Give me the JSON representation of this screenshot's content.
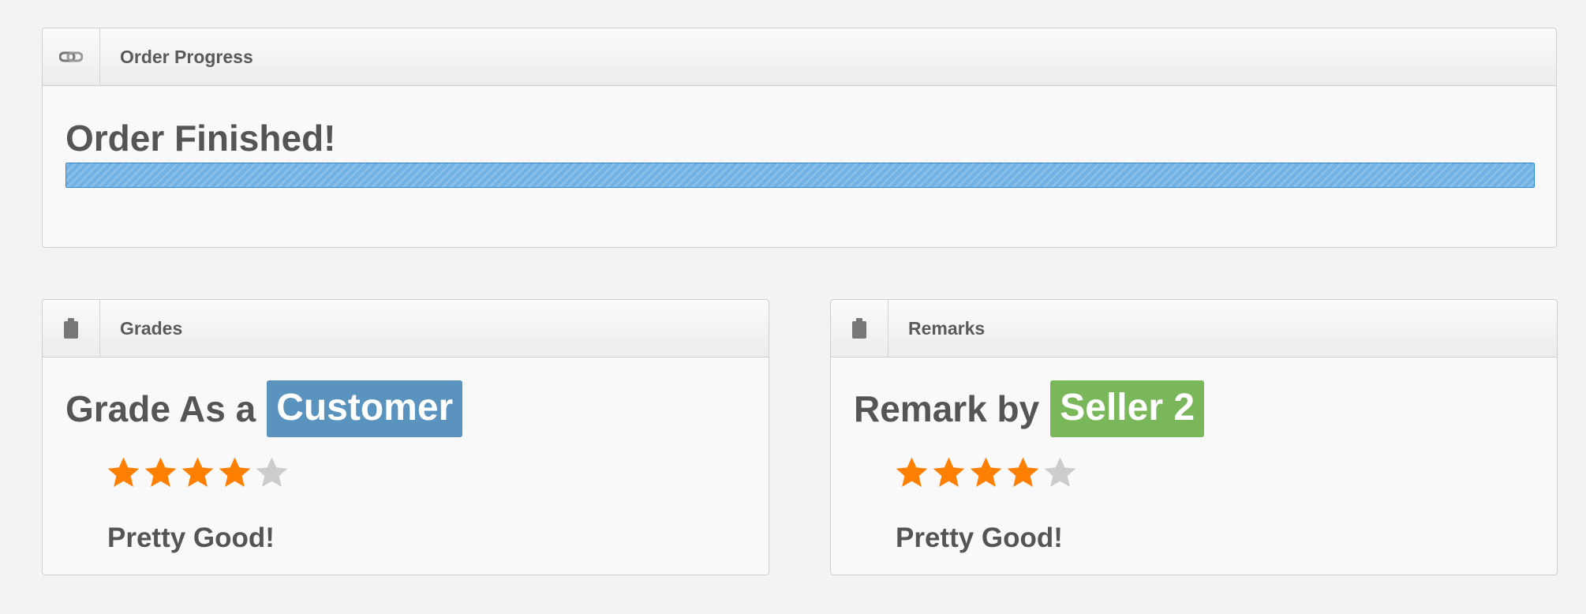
{
  "progress_panel": {
    "title": "Order Progress",
    "icon": "link-icon",
    "status_text": "Order Finished!",
    "progress_percent": 100,
    "bar_color": "#71b1e3"
  },
  "grades_panel": {
    "title": "Grades",
    "icon": "clipboard-icon",
    "heading": "Grade As a",
    "badge": "Customer",
    "badge_color": "#5b93bf",
    "rating": 4,
    "max_rating": 5,
    "comment": "Pretty Good!"
  },
  "remarks_panel": {
    "title": "Remarks",
    "icon": "clipboard-icon",
    "heading": "Remark by",
    "badge": "Seller 2",
    "badge_color": "#79b75a",
    "rating": 4,
    "max_rating": 5,
    "comment": "Pretty Good!"
  },
  "colors": {
    "star_filled": "#ff7f00",
    "star_empty": "#cccccc"
  }
}
